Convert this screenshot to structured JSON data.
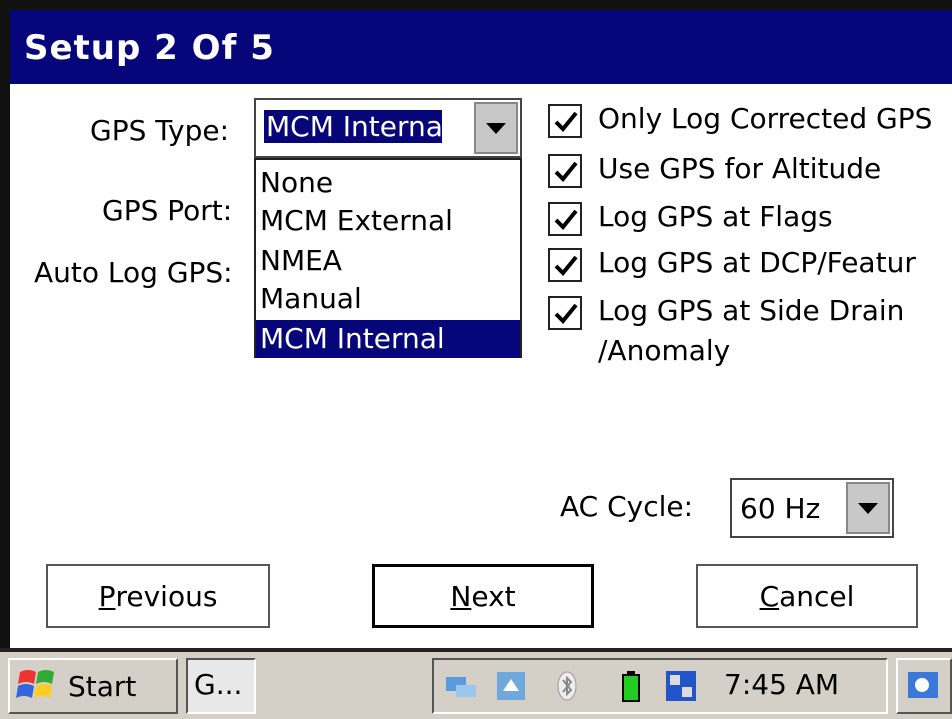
{
  "window": {
    "title": "Setup 2 Of 5"
  },
  "form": {
    "gps_type_label": "GPS Type:",
    "gps_type_value": "MCM Interna",
    "gps_port_label": "GPS Port:",
    "auto_log_label": "Auto Log GPS:",
    "gps_type_options": [
      "None",
      "MCM External",
      "NMEA",
      "Manual",
      "MCM Internal"
    ],
    "selected_option": "MCM Internal",
    "checkboxes": [
      {
        "label": "Only Log Corrected GPS",
        "checked": true
      },
      {
        "label": "Use GPS for Altitude",
        "checked": true
      },
      {
        "label": "Log GPS at Flags",
        "checked": true
      },
      {
        "label": "Log GPS at DCP/Featur",
        "checked": true
      },
      {
        "label_line1": "Log GPS at Side Drain",
        "label_line2": "/Anomaly",
        "checked": true
      }
    ],
    "ac_cycle_label": "AC  Cycle:",
    "ac_cycle_value": "60 Hz"
  },
  "buttons": {
    "previous_first": "P",
    "previous_rest": "revious",
    "next_first": "N",
    "next_rest": "ext",
    "cancel_first": "C",
    "cancel_rest": "ancel"
  },
  "taskbar": {
    "start_label": "Start",
    "task_label": "G...",
    "clock": "7:45 AM",
    "tray_icons": [
      "network-icon",
      "sync-icon",
      "bluetooth-icon",
      "battery-icon",
      "status-icon"
    ]
  },
  "colors": {
    "titlebar": "#06067a",
    "selection": "#06067a",
    "battery": "#22cc22"
  }
}
